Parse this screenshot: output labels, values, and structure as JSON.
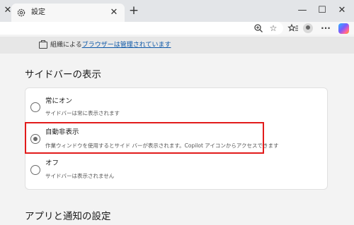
{
  "tab": {
    "title": "設定"
  },
  "window_controls": {
    "minimize": "—",
    "maximize": "☐",
    "close": "✕"
  },
  "banner": {
    "prefix": "組織による",
    "link": "ブラウザーは管理されています"
  },
  "sections": {
    "sidebar_title": "サイドバーの表示",
    "apps_title": "アプリと通知の設定"
  },
  "options": [
    {
      "title": "常にオン",
      "description": "サイドバーは常に表示されます",
      "selected": false
    },
    {
      "title": "自動非表示",
      "description": "作業ウィンドウを使用するとサイド バーが表示されます。Copilot アイコンからアクセスできます",
      "selected": true
    },
    {
      "title": "オフ",
      "description": "サイドバーは表示されません",
      "selected": false
    }
  ],
  "colors": {
    "highlight": "#e21b1b",
    "link": "#0b57a8"
  }
}
